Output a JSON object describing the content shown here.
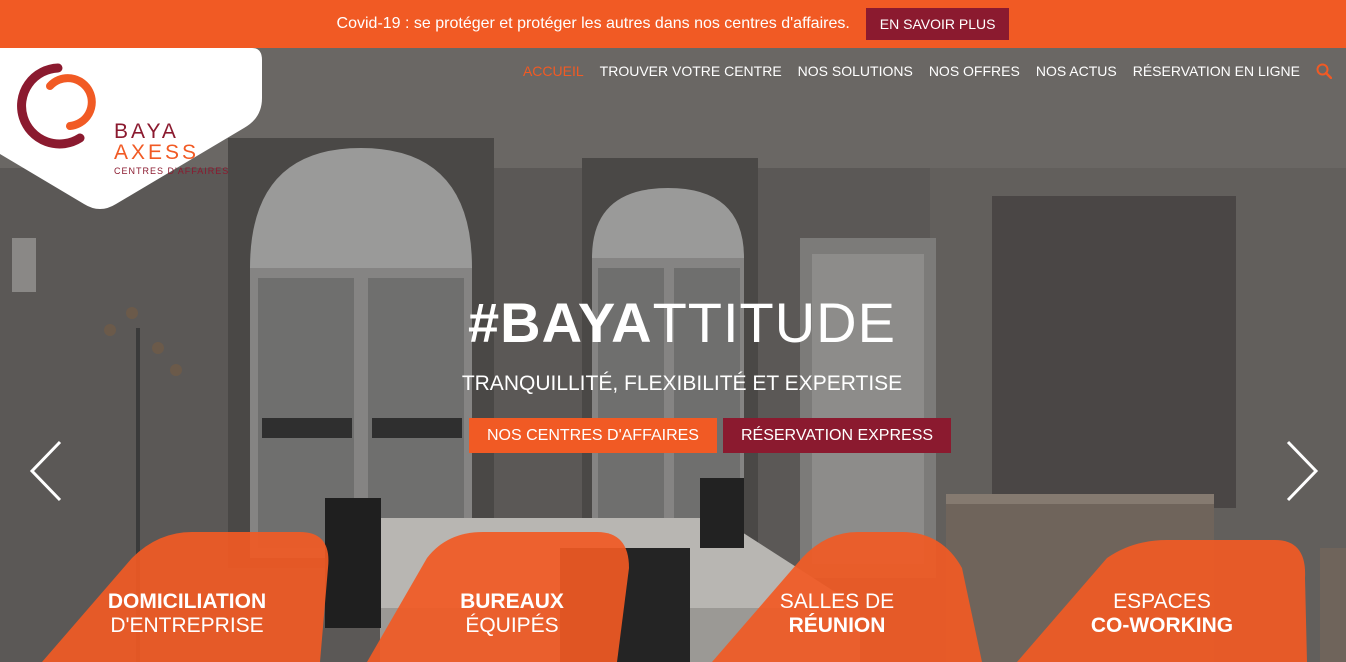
{
  "banner": {
    "text": "Covid-19 : se protéger et protéger les autres dans nos centres d'affaires.",
    "button_label": "EN SAVOIR PLUS"
  },
  "logo": {
    "line1": "BAYA",
    "line2": "AXESS",
    "line3": "CENTRES D'AFFAIRES"
  },
  "nav": {
    "items": [
      {
        "label": "ACCUEIL"
      },
      {
        "label": "TROUVER VOTRE CENTRE"
      },
      {
        "label": "NOS SOLUTIONS"
      },
      {
        "label": "NOS OFFRES"
      },
      {
        "label": "NOS ACTUS"
      },
      {
        "label": "RÉSERVATION EN LIGNE"
      }
    ],
    "search_icon": "search-icon"
  },
  "hero": {
    "title_bold": "#BAYA",
    "title_light": "TTITUDE",
    "subtitle": "TRANQUILLITÉ, FLEXIBILITÉ ET EXPERTISE",
    "button_primary": "NOS CENTRES D'AFFAIRES",
    "button_secondary": "RÉSERVATION EXPRESS"
  },
  "services": [
    {
      "bold": "DOMICILIATION",
      "normal": "D'ENTREPRISE"
    },
    {
      "bold": "BUREAUX",
      "normal": "ÉQUIPÉS"
    },
    {
      "normal": "SALLES DE",
      "bold": "RÉUNION"
    },
    {
      "normal": "ESPACES",
      "bold": "CO-WORKING"
    }
  ],
  "colors": {
    "accent": "#f15a24",
    "brand": "#8b1a2f"
  }
}
